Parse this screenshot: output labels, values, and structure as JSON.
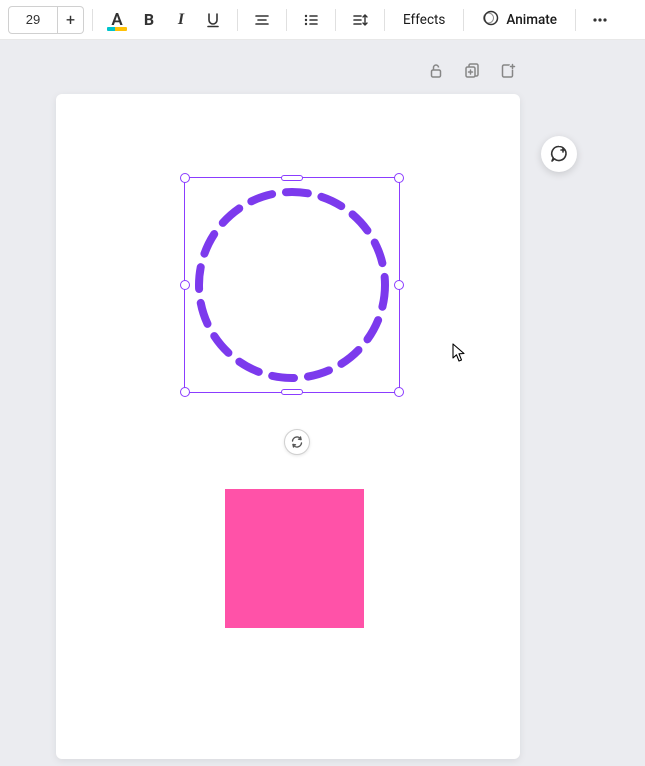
{
  "toolbar": {
    "font_size": "29",
    "plus": "+",
    "text_color_glyph": "A",
    "bold_glyph": "B",
    "italic_glyph": "I",
    "effects_label": "Effects",
    "animate_label": "Animate"
  },
  "icons": {
    "text_color": "text-color-icon",
    "bold": "bold-icon",
    "italic": "italic-icon",
    "underline": "underline-icon",
    "align": "align-icon",
    "list": "list-icon",
    "spacing": "spacing-icon",
    "animate": "animate-icon",
    "more": "more-icon",
    "lock": "lock-icon",
    "duplicate": "duplicate-icon",
    "add_page": "add-page-icon",
    "rotate": "rotate-icon",
    "comment": "comment-add-icon",
    "cursor": "cursor-icon"
  },
  "shapes": {
    "circle_color": "#7c3aed",
    "square_color": "#ff52a8",
    "selection_color": "#8b3dff"
  }
}
